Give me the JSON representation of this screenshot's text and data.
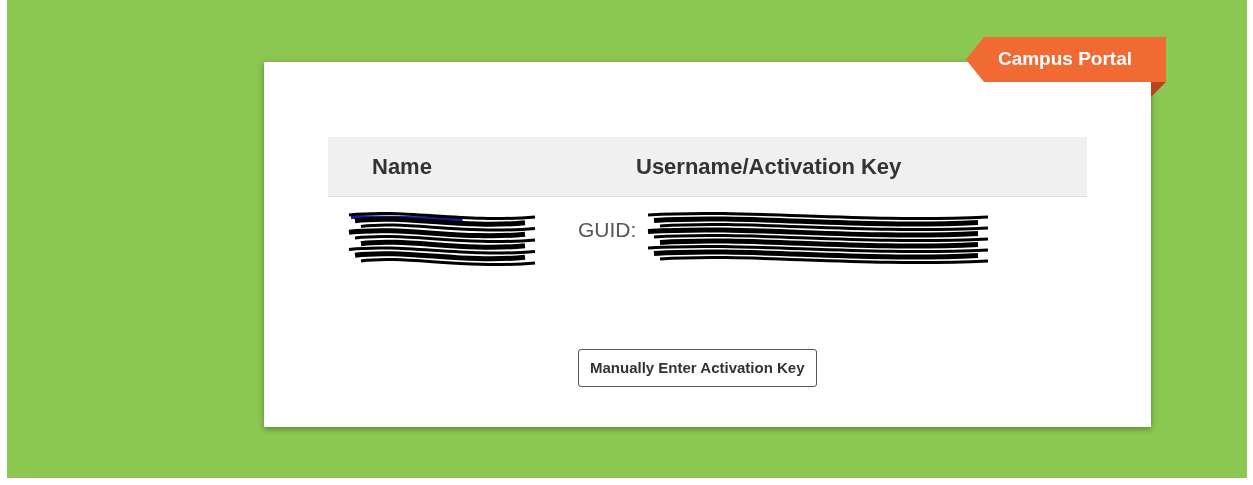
{
  "ribbon": {
    "label": "Campus Portal"
  },
  "table": {
    "columns": [
      "Name",
      "Username/Activation Key"
    ],
    "rows": [
      {
        "name_redacted": true,
        "key_label": "GUID:",
        "key_redacted": true
      }
    ]
  },
  "button": {
    "label": "Manually Enter Activation Key"
  }
}
